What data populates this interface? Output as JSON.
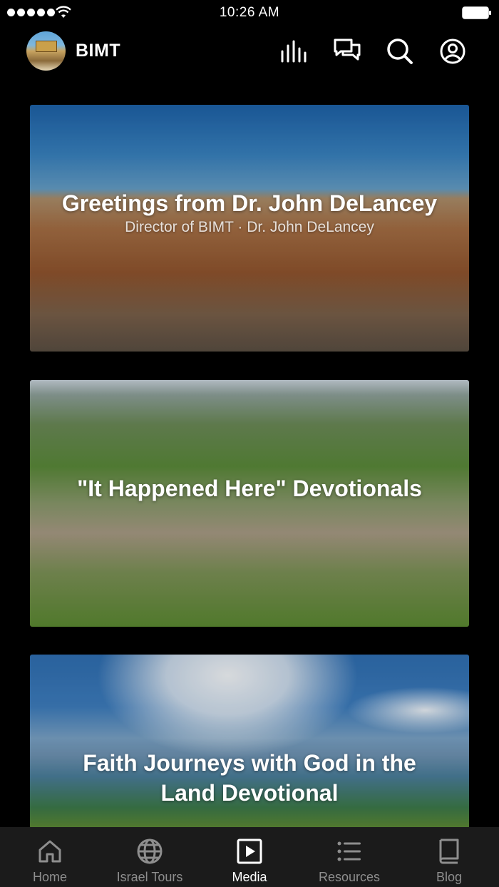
{
  "status_bar": {
    "time": "10:26 AM",
    "signal_icon": "signal-dots-icon",
    "wifi_icon": "wifi-icon",
    "battery_icon": "battery-icon"
  },
  "header": {
    "brand": "BIMT",
    "logo_icon": "app-logo-icon",
    "icons": [
      "equalizer-icon",
      "chat-icon",
      "search-icon",
      "profile-icon"
    ]
  },
  "cards": [
    {
      "title": "Greetings from Dr. John DeLancey",
      "subtitle": "Director of BIMT · Dr. John DeLancey"
    },
    {
      "title": "\"It Happened Here\" Devotionals",
      "subtitle": ""
    },
    {
      "title": "Faith Journeys with God in the Land Devotional",
      "subtitle": ""
    }
  ],
  "tab_bar": {
    "active": "Media",
    "tabs": [
      {
        "label": "Home",
        "icon": "home-icon"
      },
      {
        "label": "Israel Tours",
        "icon": "globe-icon"
      },
      {
        "label": "Media",
        "icon": "play-icon"
      },
      {
        "label": "Resources",
        "icon": "list-icon"
      },
      {
        "label": "Blog",
        "icon": "book-icon"
      }
    ]
  },
  "colors": {
    "background": "#000000",
    "tab_bar": "#1b1b1b",
    "tab_inactive": "#8e8e8e",
    "tab_active": "#ffffff"
  }
}
